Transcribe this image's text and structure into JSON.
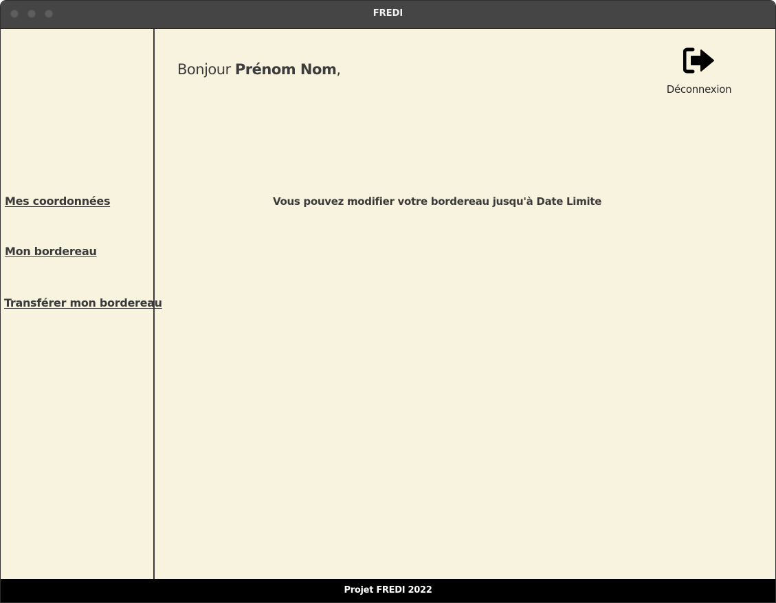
{
  "window": {
    "title": "FREDI"
  },
  "sidebar": {
    "items": [
      {
        "label": "Mes coordonnées"
      },
      {
        "label": "Mon bordereau"
      },
      {
        "label": "Transférer mon bordereau"
      }
    ]
  },
  "header": {
    "greeting_prefix": "Bonjour ",
    "user_name": "Prénom Nom",
    "greeting_suffix": ",",
    "logout_label": "Déconnexion",
    "logout_icon": "sign-out-icon"
  },
  "main": {
    "notice": "Vous pouvez modifier votre bordereau jusqu'à Date Limite"
  },
  "footer": {
    "text": "Projet FREDI 2022"
  },
  "colors": {
    "background": "#f8f3df",
    "titlebar": "#454545",
    "footer": "#000000",
    "text": "#3a3a3a"
  }
}
